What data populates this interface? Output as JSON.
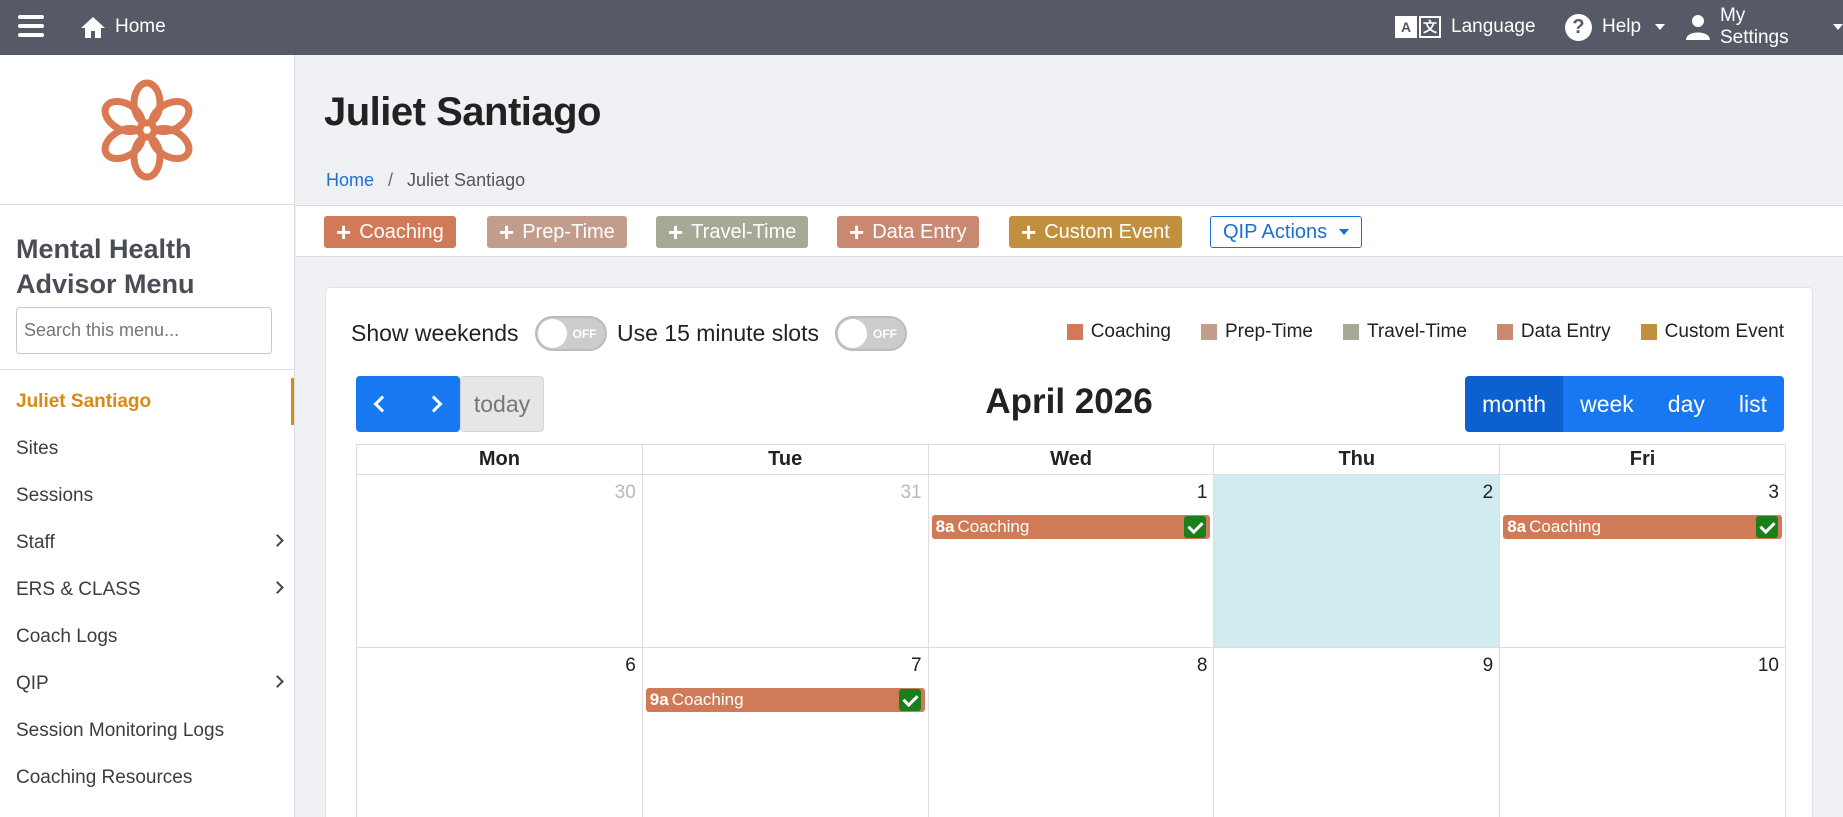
{
  "topbar": {
    "home_label": "Home",
    "language_label": "Language",
    "help_label": "Help",
    "settings_label": "My Settings"
  },
  "sidebar": {
    "menu_title": "Mental Health Advisor Menu",
    "search_placeholder": "Search this menu...",
    "items": [
      {
        "label": "Juliet Santiago",
        "active": true,
        "has_submenu": false
      },
      {
        "label": "Sites",
        "has_submenu": false
      },
      {
        "label": "Sessions",
        "has_submenu": false
      },
      {
        "label": "Staff",
        "has_submenu": true
      },
      {
        "label": "ERS & CLASS",
        "has_submenu": true
      },
      {
        "label": "Coach Logs",
        "has_submenu": false
      },
      {
        "label": "QIP",
        "has_submenu": true
      },
      {
        "label": "Session Monitoring Logs",
        "has_submenu": false
      },
      {
        "label": "Coaching Resources",
        "has_submenu": false
      }
    ]
  },
  "page": {
    "title": "Juliet Santiago",
    "breadcrumb": {
      "home": "Home",
      "separator": "/",
      "current": "Juliet Santiago"
    }
  },
  "actions": {
    "coaching": "Coaching",
    "prep_time": "Prep-Time",
    "travel_time": "Travel-Time",
    "data_entry": "Data Entry",
    "custom_event": "Custom Event",
    "qip_actions": "QIP Actions"
  },
  "colors": {
    "coaching": "#d17a58",
    "prep_time": "#c39d8c",
    "travel_time": "#a7a996",
    "data_entry": "#c98870",
    "custom_event": "#c18f3e",
    "accent": "#1778f2",
    "active_menu": "#d88a15"
  },
  "calendar": {
    "show_weekends_label": "Show weekends",
    "slots_label": "Use 15 minute slots",
    "toggle_off": "OFF",
    "legend": {
      "coaching": "Coaching",
      "prep_time": "Prep-Time",
      "travel_time": "Travel-Time",
      "data_entry": "Data Entry",
      "custom_event": "Custom Event"
    },
    "today_label": "today",
    "title": "April 2026",
    "views": {
      "month": "month",
      "week": "week",
      "day": "day",
      "list": "list"
    },
    "active_view": "month",
    "day_headers": [
      "Mon",
      "Tue",
      "Wed",
      "Thu",
      "Fri"
    ],
    "week1": [
      "30",
      "31",
      "1",
      "2",
      "3"
    ],
    "week2": [
      "6",
      "7",
      "8",
      "9",
      "10"
    ],
    "events": {
      "wed1": {
        "time": "8a",
        "title": "Coaching"
      },
      "fri3": {
        "time": "8a",
        "title": "Coaching"
      },
      "tue7": {
        "time": "9a",
        "title": "Coaching"
      }
    }
  }
}
